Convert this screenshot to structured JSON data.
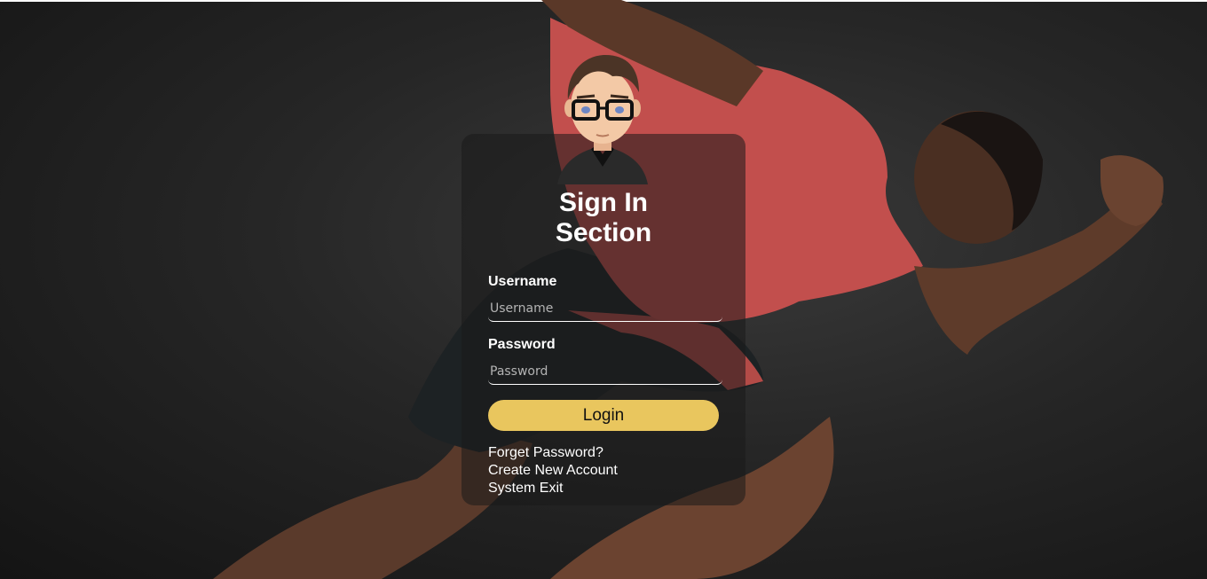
{
  "login": {
    "title_line1": "Sign In",
    "title_line2": "Section",
    "username_label": "Username",
    "username_placeholder": "Username",
    "password_label": "Password",
    "password_placeholder": "Password",
    "login_button": "Login",
    "forget_password": "Forget Password?",
    "create_account": "Create New Account",
    "system_exit": "System Exit"
  },
  "colors": {
    "accent": "#e9c65e",
    "shirt": "#c4504f",
    "background": "#1e1e1e"
  }
}
